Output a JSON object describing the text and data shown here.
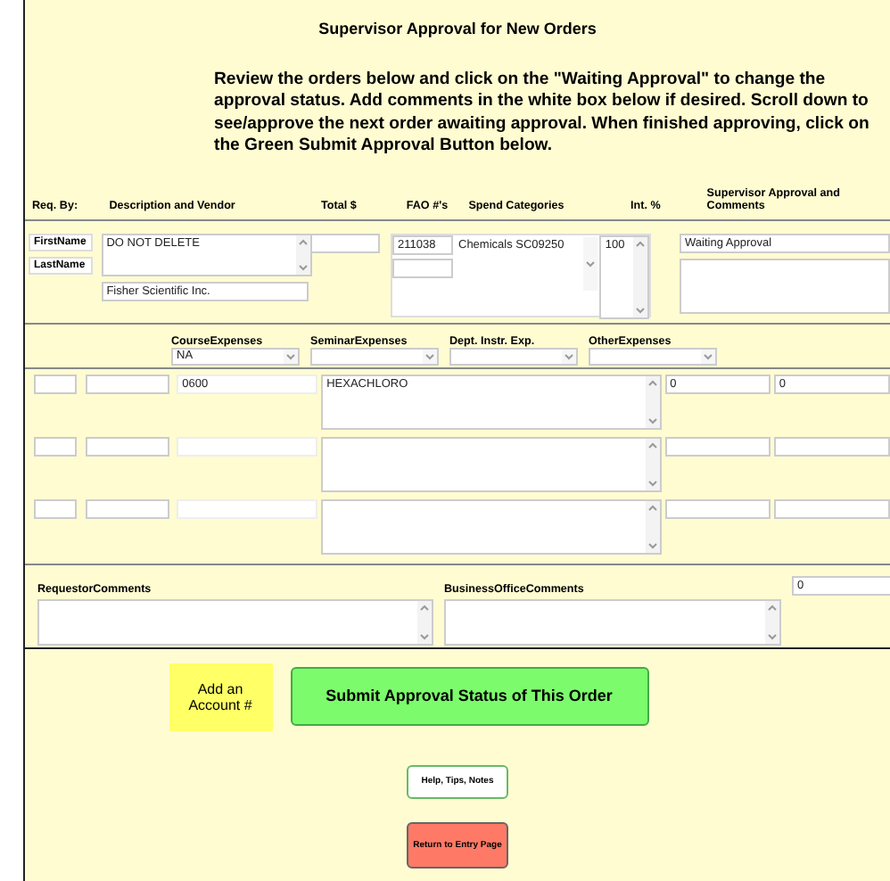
{
  "title": "Supervisor Approval for New Orders",
  "instructions": "Review the orders below and click on the \"Waiting Approval\" to change the approval status.  Add comments in the white box below if desired.  Scroll down to see/approve the next order awaiting approval.  When finished approving, click on the Green Submit Approval Button below.",
  "columns": [
    "Req. By:",
    "Description and Vendor",
    "Total $",
    "FAO #'s",
    "Spend Categories",
    "Int. %",
    "Supervisor Approval and Comments"
  ],
  "order": {
    "first_name_label": "FirstName",
    "last_name_label": "LastName",
    "description": "DO NOT DELETE",
    "vendor": "Fisher Scientific Inc.",
    "fao": "211038",
    "spend_category": "Chemicals SC09250",
    "int_pct": "100",
    "approval_status": "Waiting Approval"
  },
  "expense_categories": [
    {
      "label": "CourseExpenses",
      "value": "NA"
    },
    {
      "label": "SeminarExpenses"
    },
    {
      "label": "Dept. Instr. Exp."
    },
    {
      "label": "OtherExpenses"
    }
  ],
  "item_rows": [
    {
      "code": "0600",
      "description": "HEXACHLORO",
      "amount_1": "0",
      "amount_2": "0"
    },
    {},
    {}
  ],
  "comments": {
    "requestor_label": "RequestorComments",
    "business_office_label": "BusinessOfficeComments",
    "side_value": "0"
  },
  "buttons": {
    "add_account": "Add an Account #",
    "submit": "Submit Approval Status of This Order",
    "help": "Help, Tips, Notes",
    "return": "Return to Entry Page"
  }
}
